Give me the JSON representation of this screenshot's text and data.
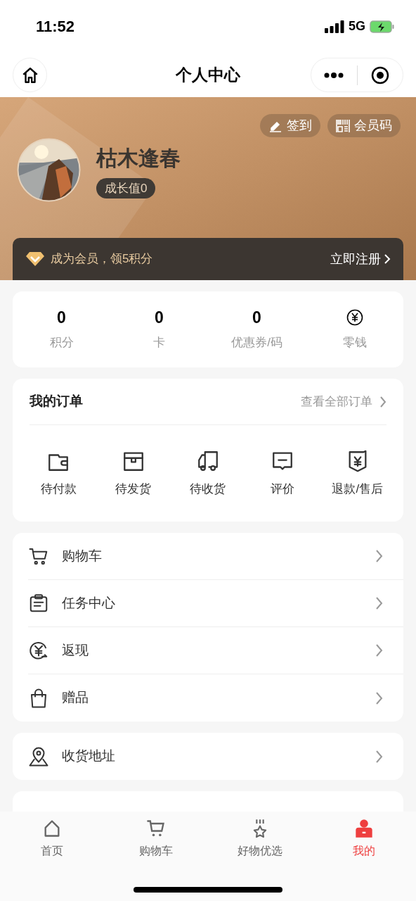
{
  "status_bar": {
    "time": "11:52",
    "network": "5G"
  },
  "nav": {
    "title": "个人中心"
  },
  "profile": {
    "actions": [
      {
        "kind": "sign",
        "label": "签到"
      },
      {
        "kind": "code",
        "label": "会员码"
      }
    ],
    "name": "枯木逢春",
    "growth": "成长值0"
  },
  "member_banner": {
    "text": "成为会员，领5积分",
    "action": "立即注册"
  },
  "stats": [
    {
      "kind": "number",
      "value": "0",
      "label": "积分"
    },
    {
      "kind": "number",
      "value": "0",
      "label": "卡"
    },
    {
      "kind": "number",
      "value": "0",
      "label": "优惠券/码"
    },
    {
      "kind": "icon",
      "label": "零钱"
    }
  ],
  "orders": {
    "title": "我的订单",
    "link": "查看全部订单",
    "items": [
      {
        "kind": "wallet",
        "label": "待付款"
      },
      {
        "kind": "box",
        "label": "待发货"
      },
      {
        "kind": "truck",
        "label": "待收货"
      },
      {
        "kind": "comment",
        "label": "评价"
      },
      {
        "kind": "refund",
        "label": "退款/售后"
      }
    ]
  },
  "menu_groups": [
    [
      {
        "kind": "cart",
        "label": "购物车"
      },
      {
        "kind": "task",
        "label": "任务中心"
      },
      {
        "kind": "cashback",
        "label": "返现"
      },
      {
        "kind": "gift",
        "label": "赠品"
      }
    ],
    [
      {
        "kind": "location",
        "label": "收货地址"
      }
    ]
  ],
  "tab_bar": [
    {
      "kind": "home",
      "label": "首页",
      "selected": false
    },
    {
      "kind": "cart",
      "label": "购物车",
      "selected": false
    },
    {
      "kind": "medal",
      "label": "好物优选",
      "selected": false
    },
    {
      "kind": "user",
      "label": "我的",
      "selected": true
    }
  ]
}
